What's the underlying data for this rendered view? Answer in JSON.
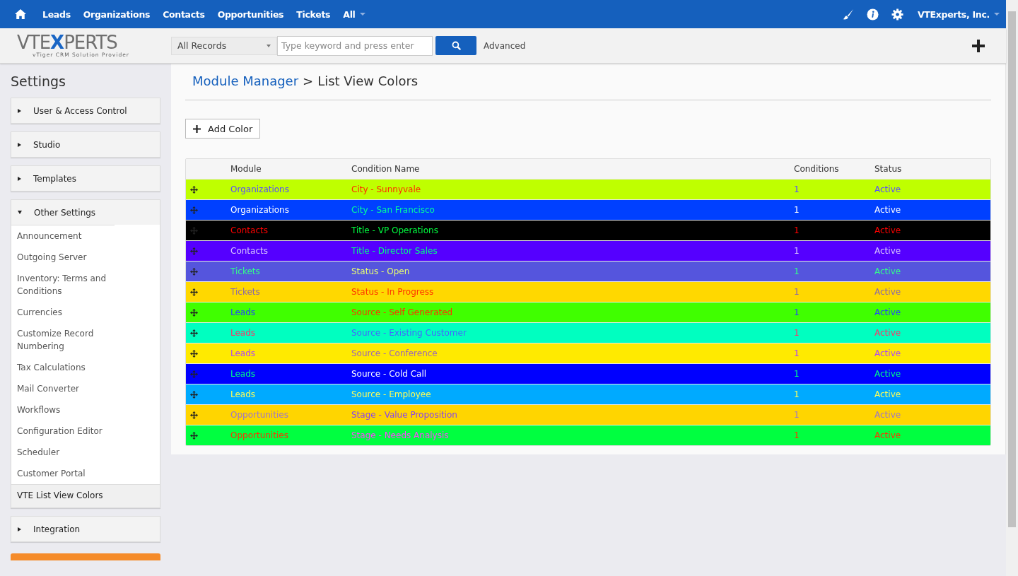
{
  "top_nav": {
    "items": [
      "Leads",
      "Organizations",
      "Contacts",
      "Opportunities",
      "Tickets"
    ],
    "all_menu": "All",
    "account": "VTExperts, Inc."
  },
  "logo": {
    "before": "VTE",
    "accent": "X",
    "after": "PERTS",
    "tagline": "vTiger CRM Solution Provider"
  },
  "search": {
    "scope": "All Records",
    "placeholder": "Type keyword and press enter",
    "advanced": "Advanced"
  },
  "sidebar": {
    "title": "Settings",
    "sections": [
      {
        "label": "User & Access Control",
        "expanded": false
      },
      {
        "label": "Studio",
        "expanded": false
      },
      {
        "label": "Templates",
        "expanded": false
      },
      {
        "label": "Other Settings",
        "expanded": true,
        "items": [
          {
            "label": "Announcement",
            "selected": false
          },
          {
            "label": "Outgoing Server",
            "selected": false
          },
          {
            "label": "Inventory: Terms and Conditions",
            "selected": false
          },
          {
            "label": "Currencies",
            "selected": false
          },
          {
            "label": "Customize Record Numbering",
            "selected": false
          },
          {
            "label": "Tax Calculations",
            "selected": false
          },
          {
            "label": "Mail Converter",
            "selected": false
          },
          {
            "label": "Workflows",
            "selected": false
          },
          {
            "label": "Configuration Editor",
            "selected": false
          },
          {
            "label": "Scheduler",
            "selected": false
          },
          {
            "label": "Customer Portal",
            "selected": false
          },
          {
            "label": "VTE List View Colors",
            "selected": true
          }
        ]
      },
      {
        "label": "Integration",
        "expanded": false
      }
    ]
  },
  "breadcrumb": {
    "parent": "Module Manager",
    "separator": ">",
    "current": "List View Colors"
  },
  "add_button": "Add Color",
  "table": {
    "columns": [
      "Module",
      "Condition Name",
      "Conditions",
      "Status"
    ],
    "rows": [
      {
        "color": "#bfff00",
        "cells": [
          {
            "text": "Organizations",
            "color": "#5a4cff"
          },
          {
            "text": "City - Sunnyvale",
            "color": "#ff2a00"
          },
          {
            "text": "1",
            "color": "#5a4cff"
          },
          {
            "text": "Active",
            "color": "#5a4cff"
          }
        ]
      },
      {
        "color": "#0040ff",
        "cells": [
          {
            "text": "Organizations",
            "color": "#ffffff"
          },
          {
            "text": "City - San Francisco",
            "color": "#00ff99"
          },
          {
            "text": "1",
            "color": "#ffffff"
          },
          {
            "text": "Active",
            "color": "#ffffff"
          }
        ]
      },
      {
        "color": "#000000",
        "cells": [
          {
            "text": "Contacts",
            "color": "#ff0000"
          },
          {
            "text": "Title - VP Operations",
            "color": "#00ff40"
          },
          {
            "text": "1",
            "color": "#ff0000"
          },
          {
            "text": "Active",
            "color": "#ff0000"
          }
        ]
      },
      {
        "color": "#5500ff",
        "cells": [
          {
            "text": "Contacts",
            "color": "#d8c8ff"
          },
          {
            "text": "Title - Director Sales",
            "color": "#00ff80"
          },
          {
            "text": "1",
            "color": "#d8c8ff"
          },
          {
            "text": "Active",
            "color": "#d8c8ff"
          }
        ]
      },
      {
        "color": "#5555dd",
        "cells": [
          {
            "text": "Tickets",
            "color": "#33ff88"
          },
          {
            "text": "Status - Open",
            "color": "#e8ff70"
          },
          {
            "text": "1",
            "color": "#33ff88"
          },
          {
            "text": "Active",
            "color": "#33ff88"
          }
        ]
      },
      {
        "color": "#ffd800",
        "cells": [
          {
            "text": "Tickets",
            "color": "#8866aa"
          },
          {
            "text": "Status - In Progress",
            "color": "#ff3300"
          },
          {
            "text": "1",
            "color": "#8866aa"
          },
          {
            "text": "Active",
            "color": "#8866aa"
          }
        ]
      },
      {
        "color": "#40ff00",
        "cells": [
          {
            "text": "Leads",
            "color": "#2244ff"
          },
          {
            "text": "Source - Self Generated",
            "color": "#ff3300"
          },
          {
            "text": "1",
            "color": "#2244ff"
          },
          {
            "text": "Active",
            "color": "#2244ff"
          }
        ]
      },
      {
        "color": "#00ffc0",
        "cells": [
          {
            "text": "Leads",
            "color": "#ff3366"
          },
          {
            "text": "Source - Existing Customer",
            "color": "#4466ff"
          },
          {
            "text": "1",
            "color": "#ff3366"
          },
          {
            "text": "Active",
            "color": "#ff3366"
          }
        ]
      },
      {
        "color": "#ffea00",
        "cells": [
          {
            "text": "Leads",
            "color": "#aa44ff"
          },
          {
            "text": "Source - Conference",
            "color": "#9966bb"
          },
          {
            "text": "1",
            "color": "#aa44ff"
          },
          {
            "text": "Active",
            "color": "#aa44ff"
          }
        ]
      },
      {
        "color": "#0000ff",
        "cells": [
          {
            "text": "Leads",
            "color": "#00ff80"
          },
          {
            "text": "Source - Cold Call",
            "color": "#ffffff"
          },
          {
            "text": "1",
            "color": "#00ff80"
          },
          {
            "text": "Active",
            "color": "#00ff80"
          }
        ]
      },
      {
        "color": "#00aaff",
        "cells": [
          {
            "text": "Leads",
            "color": "#ffff55"
          },
          {
            "text": "Source - Employee",
            "color": "#ffff55"
          },
          {
            "text": "1",
            "color": "#ffff55"
          },
          {
            "text": "Active",
            "color": "#ffff55"
          }
        ]
      },
      {
        "color": "#ffd500",
        "cells": [
          {
            "text": "Opportunities",
            "color": "#9977cc"
          },
          {
            "text": "Stage - Value Proposition",
            "color": "#8844ee"
          },
          {
            "text": "1",
            "color": "#9977cc"
          },
          {
            "text": "Active",
            "color": "#9977cc"
          }
        ]
      },
      {
        "color": "#00ff40",
        "cells": [
          {
            "text": "Opportunities",
            "color": "#ff3300"
          },
          {
            "text": "Stage - Needs Analysis",
            "color": "#ff44ff"
          },
          {
            "text": "1",
            "color": "#ff3300"
          },
          {
            "text": "Active",
            "color": "#ff3300"
          }
        ]
      }
    ]
  }
}
